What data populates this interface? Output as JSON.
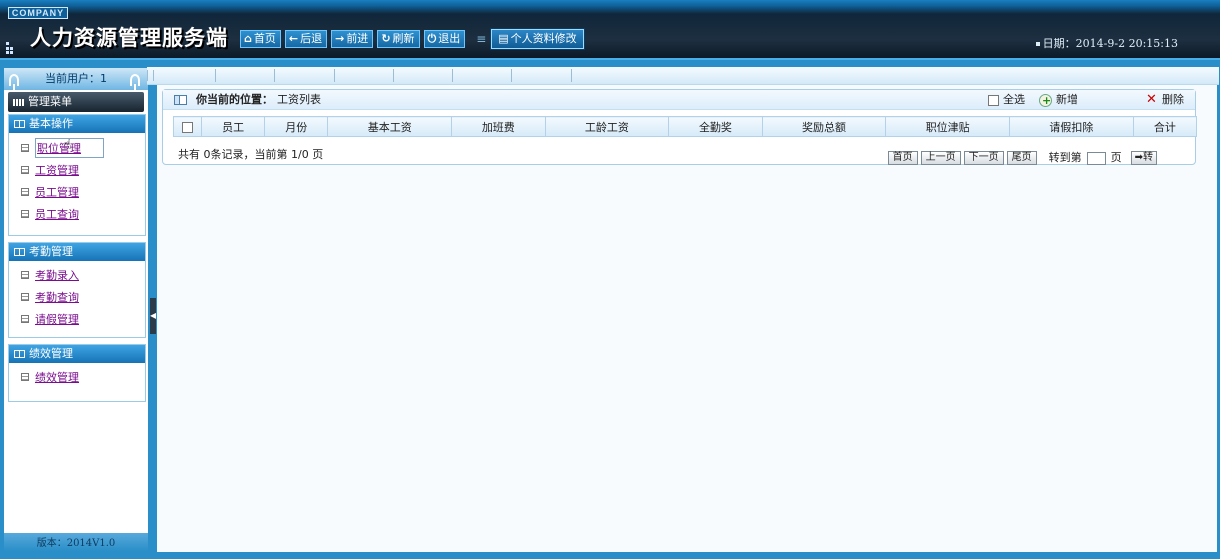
{
  "header": {
    "company": "COMPANY",
    "title": "人力资源管理服务端",
    "nav": [
      {
        "icon": "home-icon",
        "glyph": "⌂",
        "label": "首页"
      },
      {
        "icon": "back-arrow-icon",
        "glyph": "←",
        "label": "后退"
      },
      {
        "icon": "forward-arrow-icon",
        "glyph": "→",
        "label": "前进"
      },
      {
        "icon": "refresh-icon",
        "glyph": "↻",
        "label": "刷新"
      },
      {
        "icon": "power-icon",
        "glyph": "⏻",
        "label": "退出"
      }
    ],
    "profile_button": "个人资料修改",
    "date": "日期：2014-9-2 20:15:13"
  },
  "sidebar": {
    "current_user": "当前用户：1",
    "menu_title": "管理菜单",
    "sections": [
      {
        "title": "基本操作",
        "items": [
          "职位管理",
          "工资管理",
          "员工管理",
          "员工查询"
        ]
      },
      {
        "title": "考勤管理",
        "items": [
          "考勤录入",
          "考勤查询",
          "请假管理"
        ]
      },
      {
        "title": "绩效管理",
        "items": [
          "绩效管理"
        ]
      }
    ],
    "version": "版本：2014V1.0"
  },
  "main": {
    "location_label": "你当前的位置：",
    "location_value": "工资列表",
    "select_all": "全选",
    "add": "新增",
    "delete": "删除",
    "columns": [
      "员工",
      "月份",
      "基本工资",
      "加班费",
      "工龄工资",
      "全勤奖",
      "奖励总额",
      "职位津贴",
      "请假扣除",
      "合计"
    ],
    "pager": {
      "total": "共有  0条记录，当前第  1/0 页",
      "first": "首页",
      "prev": "上一页",
      "next": "下一页",
      "last": "尾页",
      "goto_prefix": "转到第",
      "goto_suffix": "页",
      "go": "转"
    }
  },
  "colors": {
    "accent": "#2a8fc8",
    "header_dark": "#1d2f40",
    "link": "#7a0d8e"
  }
}
